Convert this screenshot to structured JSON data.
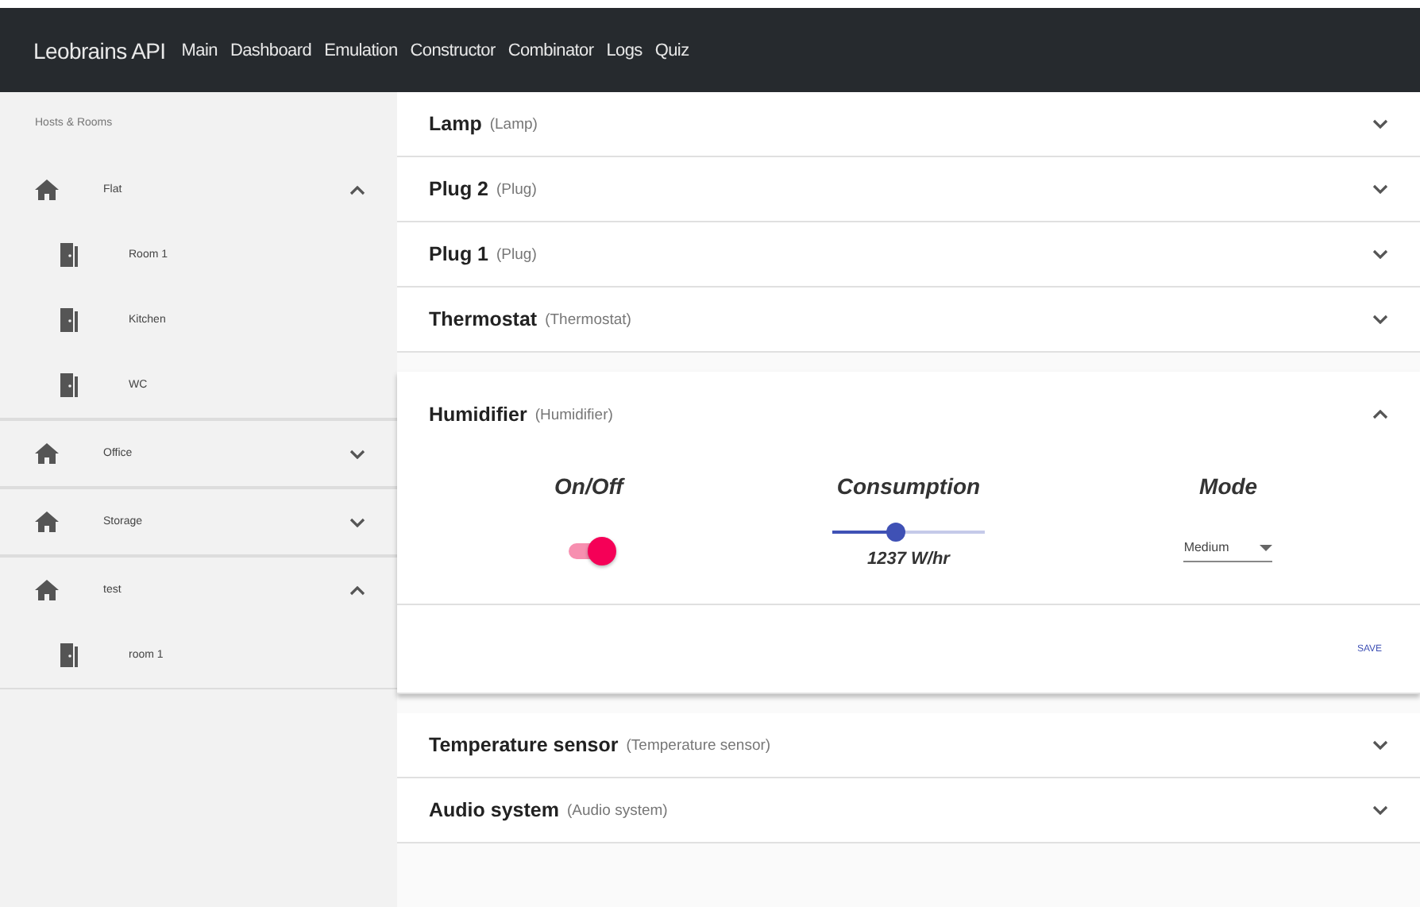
{
  "header": {
    "brand": "Leobrains API",
    "nav": [
      {
        "label": "Main"
      },
      {
        "label": "Dashboard"
      },
      {
        "label": "Emulation"
      },
      {
        "label": "Constructor"
      },
      {
        "label": "Combinator"
      },
      {
        "label": "Logs"
      },
      {
        "label": "Quiz"
      }
    ]
  },
  "sidebar": {
    "title": "Hosts & Rooms",
    "hosts": [
      {
        "name": "Flat",
        "expanded": true,
        "children": [
          {
            "name": "Room 1"
          },
          {
            "name": "Kitchen"
          },
          {
            "name": "WC"
          }
        ]
      },
      {
        "name": "Office",
        "expanded": false
      },
      {
        "name": "Storage",
        "expanded": false
      },
      {
        "name": "test",
        "expanded": true,
        "children": [
          {
            "name": "room 1"
          }
        ]
      }
    ]
  },
  "devices": [
    {
      "name": "Lamp",
      "type": "(Lamp)",
      "expanded": false
    },
    {
      "name": "Plug 2",
      "type": "(Plug)",
      "expanded": false
    },
    {
      "name": "Plug 1",
      "type": "(Plug)",
      "expanded": false
    },
    {
      "name": "Thermostat",
      "type": "(Thermostat)",
      "expanded": false
    },
    {
      "name": "Humidifier",
      "type": "(Humidifier)",
      "expanded": true,
      "controls": [
        {
          "kind": "switch",
          "label": "On/Off",
          "on": true
        },
        {
          "kind": "slider",
          "label": "Consumption",
          "level": 0.42,
          "reading": "1237 W/hr"
        },
        {
          "kind": "select",
          "label": "Mode",
          "value": "Medium"
        }
      ],
      "action": "SAVE"
    },
    {
      "name": "Temperature sensor",
      "type": "(Temperature sensor)",
      "expanded": false
    },
    {
      "name": "Audio system",
      "type": "(Audio system)",
      "expanded": false
    }
  ]
}
